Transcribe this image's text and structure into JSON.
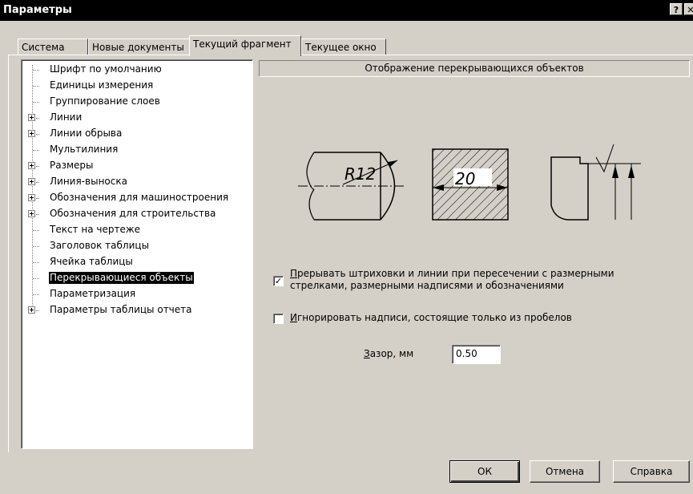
{
  "window": {
    "title": "Параметры",
    "help_glyph": "?",
    "close_glyph": "✕"
  },
  "tabs": [
    {
      "label": "Система",
      "active": false
    },
    {
      "label": "Новые документы",
      "active": false
    },
    {
      "label": "Текущий фрагмент",
      "active": true
    },
    {
      "label": "Текущее окно",
      "active": false
    }
  ],
  "tree": [
    {
      "label": "Шрифт по умолчанию",
      "expandable": false
    },
    {
      "label": "Единицы измерения",
      "expandable": false
    },
    {
      "label": "Группирование слоев",
      "expandable": false
    },
    {
      "label": "Линии",
      "expandable": true
    },
    {
      "label": "Линии обрыва",
      "expandable": true
    },
    {
      "label": "Мультилиния",
      "expandable": false
    },
    {
      "label": "Размеры",
      "expandable": true
    },
    {
      "label": "Линия-выноска",
      "expandable": true
    },
    {
      "label": "Обозначения для машиностроения",
      "expandable": true
    },
    {
      "label": "Обозначения для строительства",
      "expandable": true
    },
    {
      "label": "Текст на чертеже",
      "expandable": false
    },
    {
      "label": "Заголовок таблицы",
      "expandable": false
    },
    {
      "label": "Ячейка таблицы",
      "expandable": false
    },
    {
      "label": "Перекрывающиеся объекты",
      "expandable": false,
      "selected": true
    },
    {
      "label": "Параметризация",
      "expandable": false
    },
    {
      "label": "Параметры таблицы отчета",
      "expandable": true
    }
  ],
  "section": {
    "title": "Отображение перекрывающихся объектов"
  },
  "illustration": {
    "radius_label": "R12",
    "dimension_label": "20"
  },
  "options": {
    "break_hatching": {
      "checked": true,
      "mnemonic": "П",
      "rest_line1": "рерывать штриховки и линии при пересечении с размерными",
      "line2": "стрелками, размерными надписями и обозначениями"
    },
    "ignore_blank": {
      "checked": false,
      "mnemonic": "И",
      "rest": "гнорировать надписи, состоящие только из пробелов"
    }
  },
  "gap": {
    "mnemonic": "З",
    "rest": "азор, мм",
    "value": "0.50"
  },
  "buttons": {
    "ok": "ОК",
    "cancel": "Отмена",
    "help": "Справка"
  }
}
